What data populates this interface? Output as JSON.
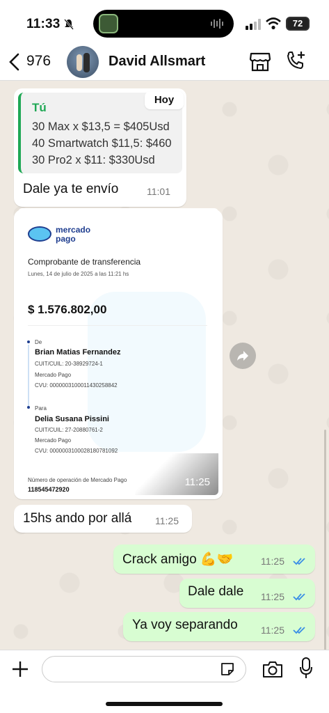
{
  "status_bar": {
    "time": "11:33",
    "battery": "72"
  },
  "header": {
    "back_count": "976",
    "contact_name": "David Allsmart"
  },
  "messages": {
    "quote": {
      "author": "Tú",
      "lines": [
        "30 Max x $13,5 = $405Usd",
        "40 Smartwatch $11,5: $460",
        "30 Pro2 x $11: $330Usd"
      ]
    },
    "date_pill": "Hoy",
    "reply": {
      "text": "Dale ya te envío",
      "time": "11:01"
    },
    "receipt": {
      "brand_line1": "mercado",
      "brand_line2": "pago",
      "title": "Comprobante de transferencia",
      "date": "Lunes, 14 de julio de 2025 a las 11:21 hs",
      "amount": "$ 1.576.802,00",
      "from_label": "De",
      "from_name": "Brian Matias Fernandez",
      "from_cuit": "CUIT/CUIL: 20-38929724-1",
      "from_bank": "Mercado Pago",
      "from_cvu": "CVU: 0000003100011430258842",
      "to_label": "Para",
      "to_name": "Delia Susana Pissini",
      "to_cuit": "CUIT/CUIL: 27-20880761-2",
      "to_bank": "Mercado Pago",
      "to_cvu": "CVU: 0000003100028180781092",
      "op_label": "Número de operación de Mercado Pago",
      "op_value": "118545472920",
      "time": "11:25"
    },
    "in_msg": {
      "text": "15hs ando por allá",
      "time": "11:25"
    },
    "out_msgs": [
      {
        "text": "Crack amigo 💪🤝",
        "time": "11:25"
      },
      {
        "text": "Dale dale",
        "time": "11:25"
      },
      {
        "text": "Ya voy separando",
        "time": "11:25"
      }
    ]
  },
  "composer": {
    "placeholder": ""
  },
  "colors": {
    "accent_green": "#1fa855",
    "outgoing_bubble": "#d8fdd2",
    "read_tick": "#3a8ee6",
    "mp_blue": "#1e3d8f"
  },
  "icons": [
    "back-icon",
    "bell-muted-icon",
    "signal-icon",
    "wifi-icon",
    "store-icon",
    "call-add-icon",
    "forward-icon",
    "read-tick-icon",
    "plus-icon",
    "sticker-icon",
    "camera-icon",
    "mic-icon"
  ]
}
